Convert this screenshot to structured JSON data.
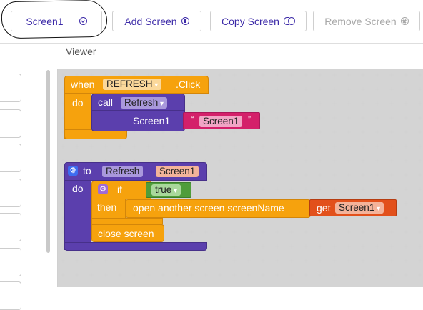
{
  "toolbar": {
    "screen_select": "Screen1",
    "add_screen": "Add Screen",
    "copy_screen": "Copy Screen",
    "remove_screen": "Remove Screen"
  },
  "viewer": {
    "title": "Viewer"
  },
  "blocks": {
    "event": {
      "when": "when",
      "component": "REFRESH",
      "event_name": ".Click",
      "do": "do",
      "call": "call",
      "procedure": "Refresh",
      "arg_name": "Screen1",
      "quote_open": "“",
      "quote_close": "”",
      "arg_value": "Screen1"
    },
    "procedure": {
      "to": "to",
      "name": "Refresh",
      "param": "Screen1",
      "do": "do",
      "if": "if",
      "condition": "true",
      "then": "then",
      "open_screen": "open another screen  screenName",
      "get": "get",
      "get_var": "Screen1",
      "close_screen": "close screen"
    }
  },
  "colors": {
    "accent": "#3c2aa8",
    "event_block": "#f6a20d",
    "procedure_block": "#5b3fad",
    "text_block": "#d4206a",
    "logic_block": "#4f9d3a",
    "variable_block": "#e2501b"
  }
}
